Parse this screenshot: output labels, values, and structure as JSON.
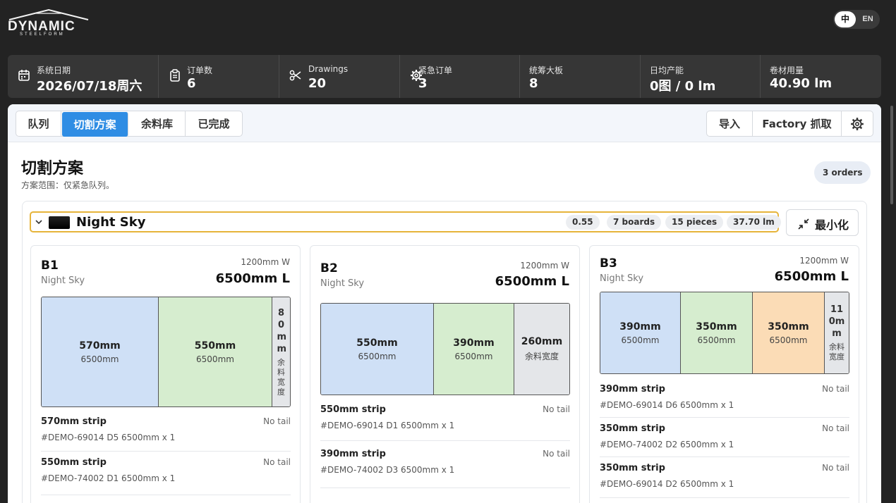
{
  "brand": {
    "word": "DYNAMIC",
    "sub": "STEELFORM"
  },
  "lang": {
    "active": "中",
    "other": "EN"
  },
  "stats": [
    {
      "icon": "calendar-icon",
      "label": "系统日期",
      "value": "2026/07/18周六"
    },
    {
      "icon": "clipboard-icon",
      "label": "订单数",
      "value": "6"
    },
    {
      "icon": "scissors-icon",
      "label": "Drawings",
      "value": "20"
    },
    {
      "icon": "gear-icon",
      "label": "紧急订单",
      "value": "3"
    },
    {
      "icon": "",
      "label": "统筹大板",
      "value": "8"
    },
    {
      "icon": "",
      "label": "日均产能",
      "value": "0图 / 0 lm"
    },
    {
      "icon": "",
      "label": "卷材用量",
      "value": "40.90 lm"
    }
  ],
  "tabs": [
    "队列",
    "切割方案",
    "余料库",
    "已完成"
  ],
  "active_tab": "切割方案",
  "actions": {
    "import": "导入",
    "factory": "Factory 抓取"
  },
  "page": {
    "title": "切割方案",
    "subtitle": "方案范围：仅紧急队列。",
    "orders": "3 orders"
  },
  "group": {
    "name": "Night Sky",
    "pills": [
      "0.55",
      "7 boards",
      "15 pieces",
      "37.70 lm"
    ],
    "minimize": "最小化"
  },
  "boards": [
    {
      "name": "B1",
      "material": "Night Sky",
      "width": "1200mm W",
      "length": "6500mm L",
      "segments": [
        {
          "w": "570mm",
          "l": "6500mm",
          "color": "#cfe0f6"
        },
        {
          "w": "550mm",
          "l": "6500mm",
          "color": "#d6edcf"
        },
        {
          "w": "80mm",
          "l": "余料宽度",
          "color": "#e4e6e9",
          "vertical": true
        }
      ],
      "strips": [
        {
          "title": "570mm strip",
          "tail": "No tail",
          "order": "#DEMO-69014 D5 6500mm x 1"
        },
        {
          "title": "550mm strip",
          "tail": "No tail",
          "order": "#DEMO-74002 D1 6500mm x 1"
        }
      ]
    },
    {
      "name": "B2",
      "material": "Night Sky",
      "width": "1200mm W",
      "length": "6500mm L",
      "segments": [
        {
          "w": "550mm",
          "l": "6500mm",
          "color": "#cfe0f6"
        },
        {
          "w": "390mm",
          "l": "6500mm",
          "color": "#d6edcf"
        },
        {
          "w": "260mm",
          "l": "余料宽度",
          "color": "#e4e6e9"
        }
      ],
      "strips": [
        {
          "title": "550mm strip",
          "tail": "No tail",
          "order": "#DEMO-69014 D1 6500mm x 1"
        },
        {
          "title": "390mm strip",
          "tail": "No tail",
          "order": "#DEMO-74002 D3 6500mm x 1"
        }
      ]
    },
    {
      "name": "B3",
      "material": "Night Sky",
      "width": "1200mm W",
      "length": "6500mm L",
      "segments": [
        {
          "w": "390mm",
          "l": "6500mm",
          "color": "#cfe0f6"
        },
        {
          "w": "350mm",
          "l": "6500mm",
          "color": "#d6edcf"
        },
        {
          "w": "350mm",
          "l": "6500mm",
          "color": "#fbdcb6"
        },
        {
          "w": "110mm",
          "l": "余料宽度",
          "color": "#e4e6e9",
          "vertical": true
        }
      ],
      "strips": [
        {
          "title": "390mm strip",
          "tail": "No tail",
          "order": "#DEMO-69014 D6 6500mm x 1"
        },
        {
          "title": "350mm strip",
          "tail": "No tail",
          "order": "#DEMO-74002 D2 6500mm x 1"
        },
        {
          "title": "350mm strip",
          "tail": "No tail",
          "order": "#DEMO-69014 D2 6500mm x 1"
        }
      ]
    }
  ]
}
